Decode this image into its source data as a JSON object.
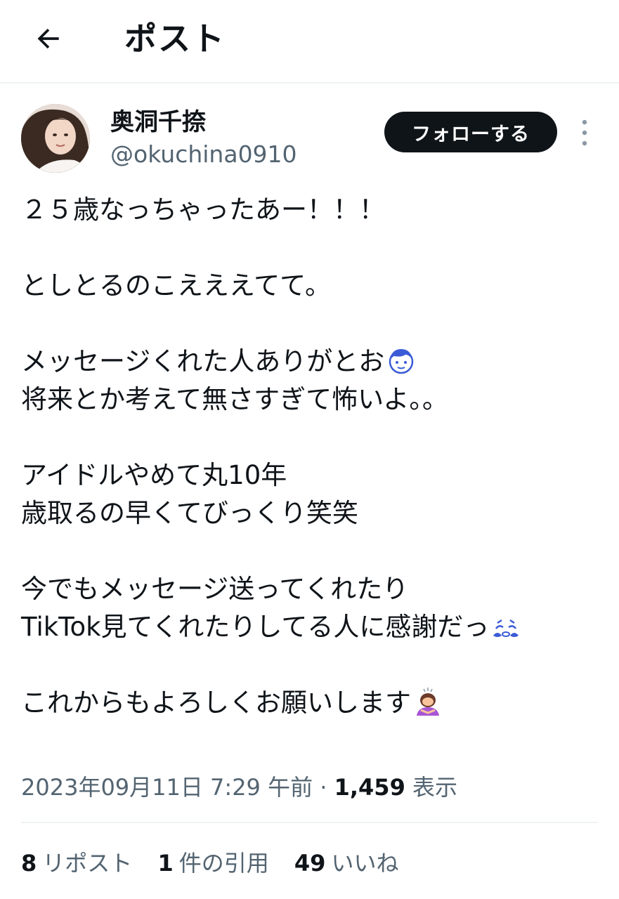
{
  "header": {
    "title": "ポスト",
    "back_icon": "arrow-left-icon"
  },
  "author": {
    "display_name": "奥洞千捺",
    "handle": "@okuchina0910",
    "follow_label": "フォローする",
    "more_icon": "more-vertical-icon"
  },
  "tweet": {
    "line1": "２５歳なっちゃったあー！！！",
    "line2": "としとるのこえええてて。",
    "line3": "メッセージくれた人ありがとお",
    "line3_emoji": "boy-face-emoji",
    "line4": "将来とか考えて無さすぎて怖いよ。。",
    "line5": "アイドルやめて丸10年",
    "line6": "歳取るの早くてびっくり笑笑",
    "line7": "今でもメッセージ送ってくれたり",
    "line8": "TikTok見てくれたりしてる人に感謝だっ",
    "line8_emoji": "crying-face-emoji",
    "line9": "これからもよろしくお願いします",
    "line9_emoji": "person-bowing-emoji"
  },
  "meta": {
    "timestamp": "2023年09月11日 7:29 午前",
    "separator": "·",
    "views_count": "1,459",
    "views_label": "表示"
  },
  "stats": {
    "reposts_count": "8",
    "reposts_label": "リポスト",
    "quotes_count": "1",
    "quotes_label": "件の引用",
    "likes_count": "49",
    "likes_label": "いいね"
  }
}
